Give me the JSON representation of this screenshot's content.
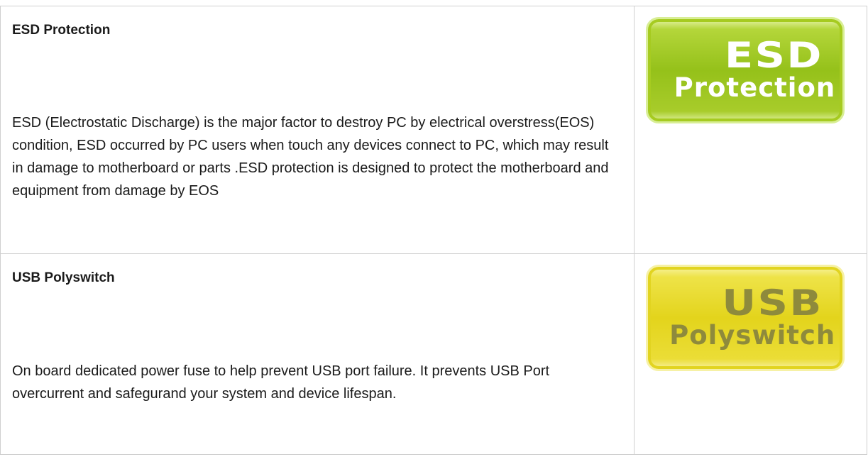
{
  "features": [
    {
      "title": "ESD Protection",
      "description": "ESD (Electrostatic Discharge) is the major factor to destroy PC by electrical overstress(EOS) condition, ESD occurred by PC users when touch any devices connect to PC, which may result in damage to motherboard or parts .ESD protection is designed to protect the motherboard and equipment from damage by EOS",
      "badge": {
        "line1": "ESD",
        "line2": "Protection",
        "color": "#95c11a",
        "text_color": "#ffffff"
      }
    },
    {
      "title": "USB Polyswitch",
      "description": "On board dedicated power fuse to help prevent USB port failure. It prevents USB Port overcurrent and safegurand your system and device lifespan.",
      "badge": {
        "line1": "USB",
        "line2": "Polyswitch",
        "color": "#e3d41c",
        "text_color": "#8e8a3c"
      }
    }
  ]
}
